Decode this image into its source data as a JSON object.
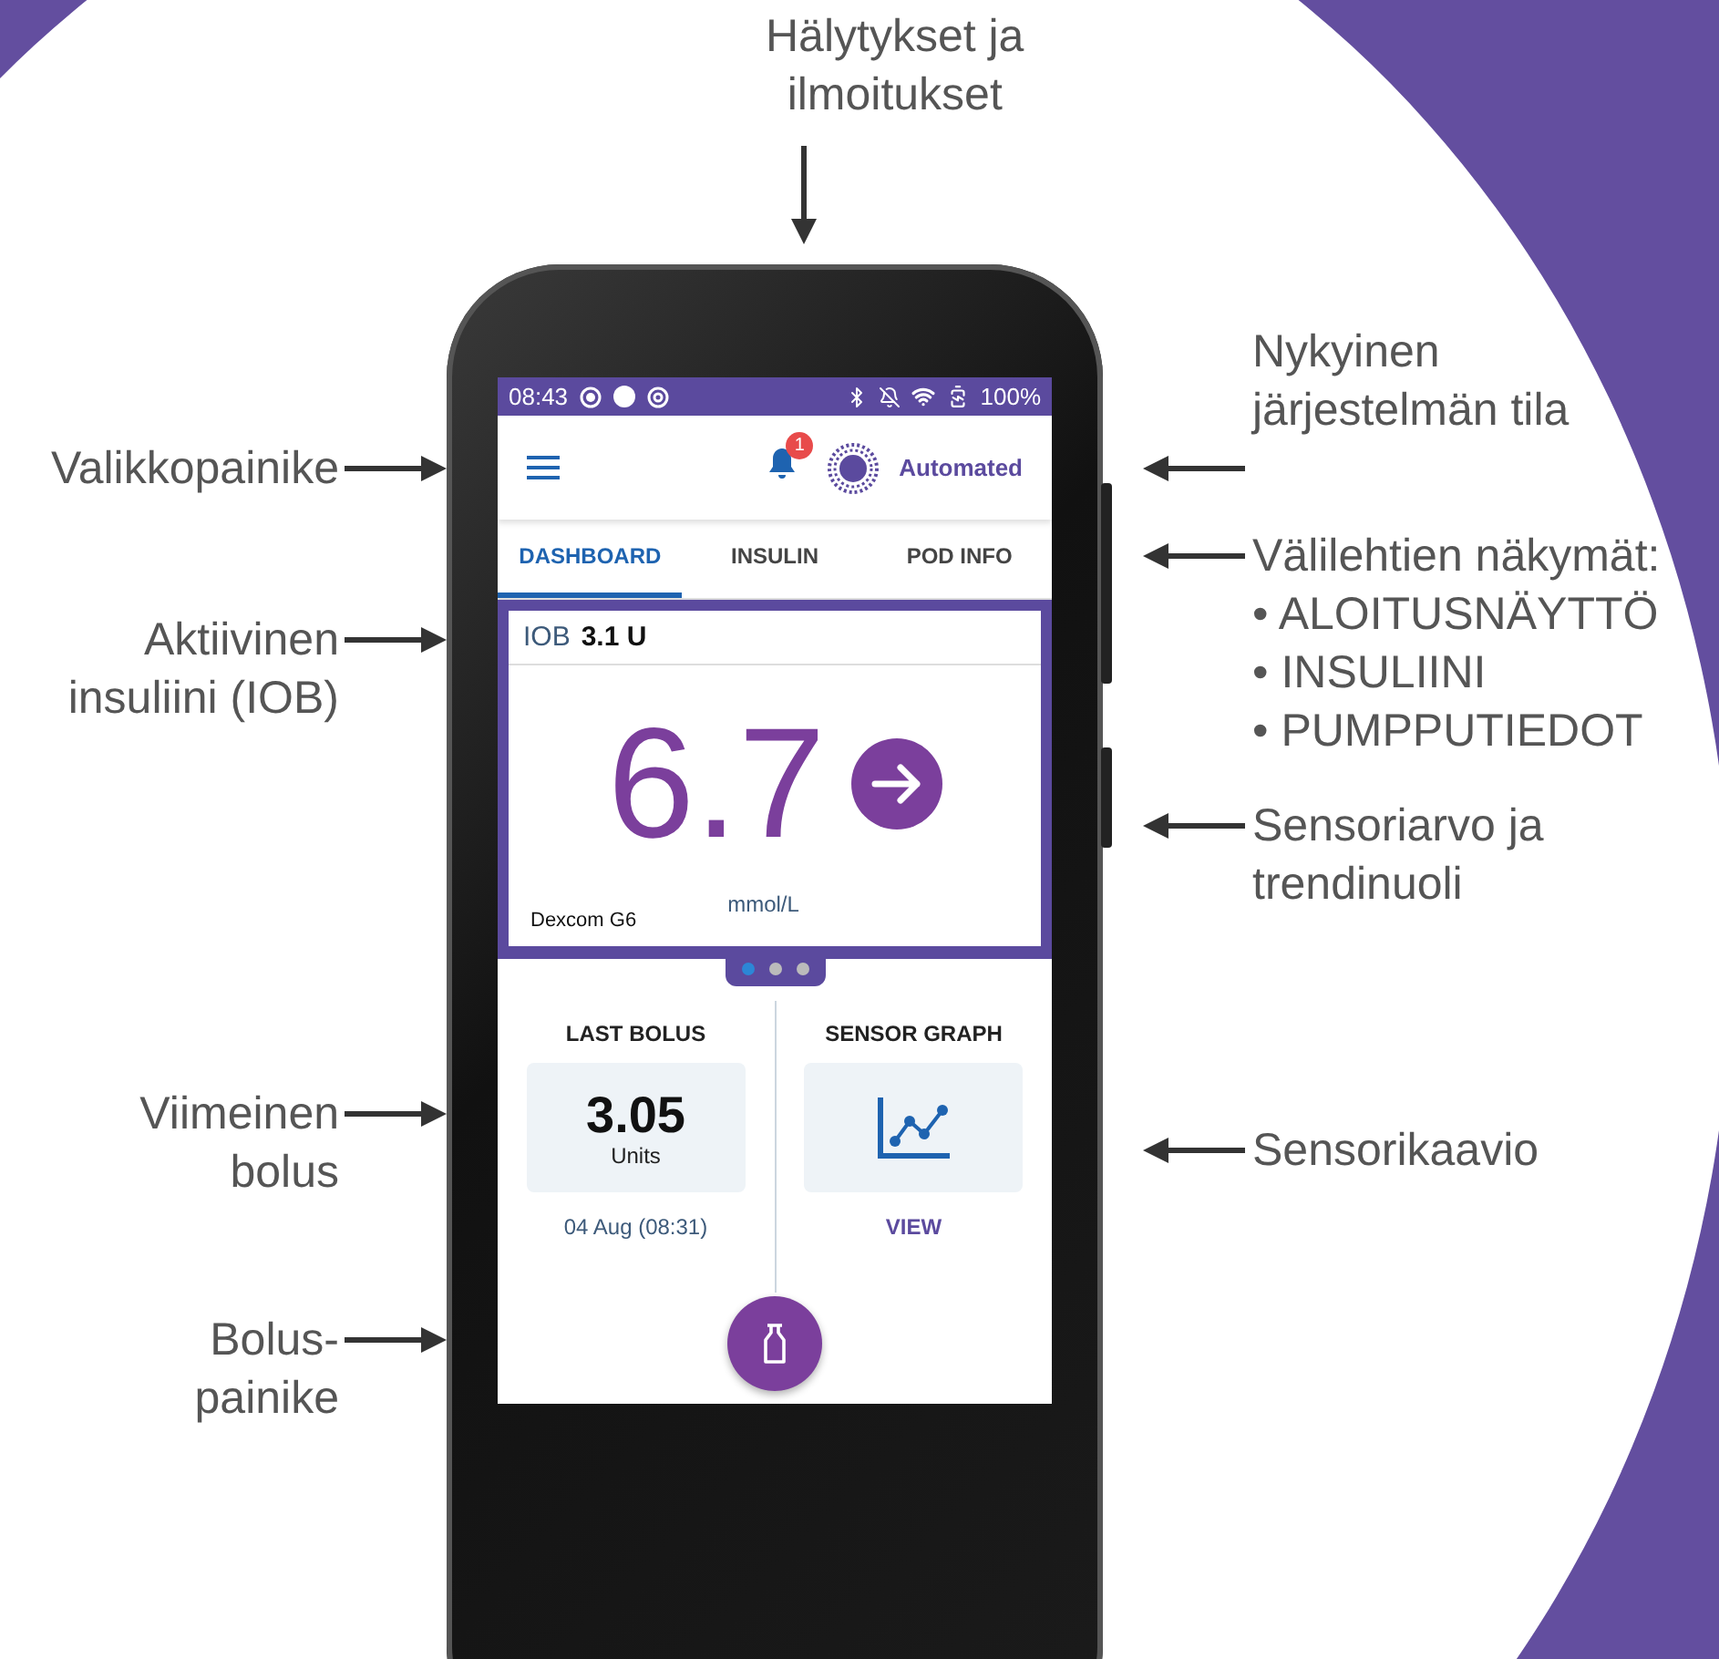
{
  "callouts": {
    "top": {
      "lines": [
        "Hälytykset ja",
        "ilmoitukset"
      ]
    },
    "left": [
      {
        "lines": [
          "Valikkopainike"
        ]
      },
      {
        "lines": [
          "Aktiivinen",
          "insuliini (IOB)"
        ]
      },
      {
        "lines": [
          "Viimeinen",
          "bolus"
        ]
      },
      {
        "lines": [
          "Bolus-",
          "painike"
        ]
      }
    ],
    "right": [
      {
        "lines": [
          "Nykyinen",
          "järjestelmän tila"
        ]
      },
      {
        "lines": [
          "Välilehtien näkymät:"
        ],
        "bullets": [
          "• ALOITUSNÄYTTÖ",
          "• INSULIINI",
          "• PUMPPUTIEDOT"
        ]
      },
      {
        "lines": [
          "Sensoriarvo ja",
          "trendinuoli"
        ]
      },
      {
        "lines": [
          "Sensorikaavio"
        ]
      }
    ]
  },
  "status_bar": {
    "time": "08:43",
    "battery": "100%"
  },
  "header": {
    "badge": "1",
    "mode": "Automated"
  },
  "tabs": [
    {
      "label": "DASHBOARD",
      "selected": true
    },
    {
      "label": "INSULIN",
      "selected": false
    },
    {
      "label": "POD INFO",
      "selected": false
    }
  ],
  "sensor_card": {
    "iob_label": "IOB",
    "iob_value": "3.1 U",
    "value": "6.7",
    "unit": "mmol/L",
    "sensor": "Dexcom G6"
  },
  "pager": [
    {
      "selected": true
    },
    {
      "selected": false
    },
    {
      "selected": false
    }
  ],
  "last_bolus": {
    "title": "LAST BOLUS",
    "value": "3.05",
    "unit": "Units",
    "time": "04 Aug (08:31)"
  },
  "sensor_graph": {
    "title": "SENSOR GRAPH",
    "action": "VIEW"
  }
}
